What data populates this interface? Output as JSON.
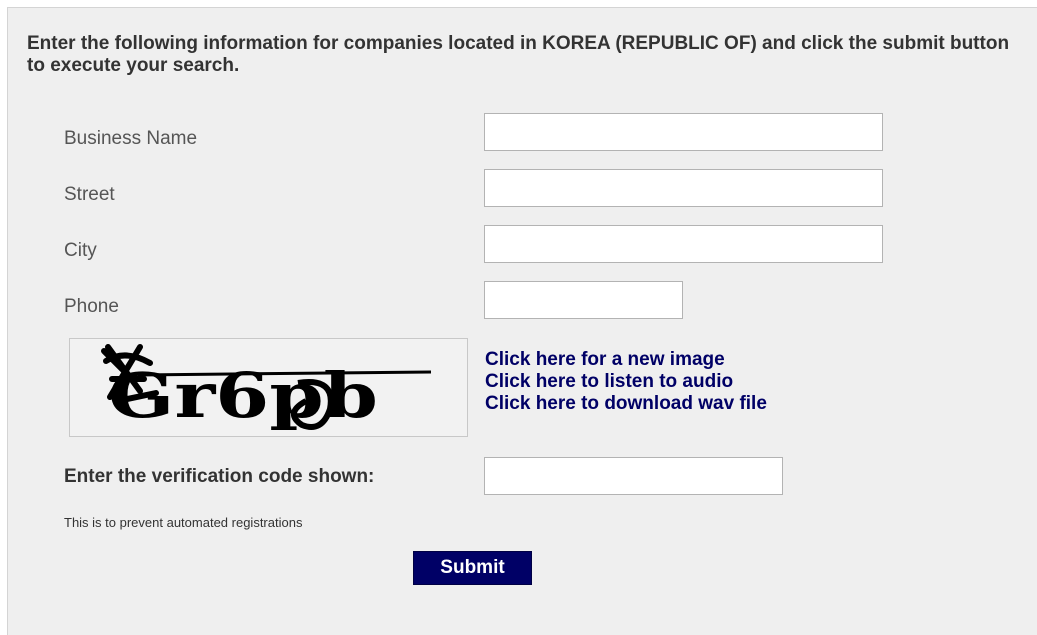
{
  "intro_text": "Enter the following information for companies located in KOREA (REPUBLIC OF) and click the submit button to execute your search.",
  "form": {
    "business_name_label": "Business Name",
    "street_label": "Street",
    "city_label": "City",
    "phone_label": "Phone",
    "business_name_value": "",
    "street_value": "",
    "city_value": "",
    "phone_value": ""
  },
  "captcha": {
    "code_text": "Gr6pb",
    "new_image_link": "Click here for a new image",
    "listen_audio_link": "Click here to listen to audio",
    "download_wav_link": "Click here to download wav file"
  },
  "verification": {
    "label": "Enter the verification code shown:",
    "value": "",
    "hint": "This is to prevent automated registrations"
  },
  "submit_label": "Submit",
  "colors": {
    "panel_background": "#efefef",
    "link_color": "#000066",
    "submit_background": "#000066",
    "submit_text": "#ffffff"
  }
}
